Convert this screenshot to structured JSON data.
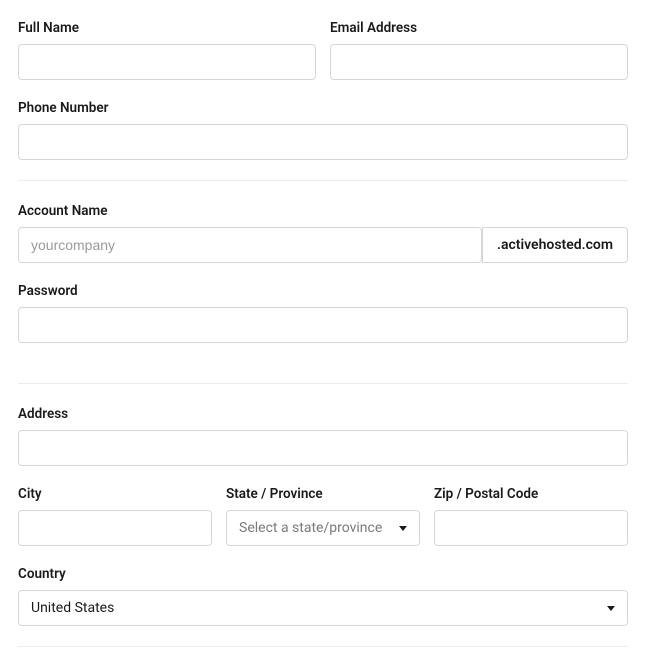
{
  "section1": {
    "full_name_label": "Full Name",
    "full_name_value": "",
    "email_label": "Email Address",
    "email_value": "",
    "phone_label": "Phone Number",
    "phone_value": ""
  },
  "section2": {
    "account_name_label": "Account Name",
    "account_name_placeholder": "yourcompany",
    "account_name_value": "",
    "account_suffix": ".activehosted.com",
    "password_label": "Password",
    "password_value": ""
  },
  "section3": {
    "address_label": "Address",
    "address_value": "",
    "city_label": "City",
    "city_value": "",
    "state_label": "State / Province",
    "state_placeholder": "Select a state/province",
    "state_value": "",
    "zip_label": "Zip / Postal Code",
    "zip_value": "",
    "country_label": "Country",
    "country_value": "United States"
  }
}
